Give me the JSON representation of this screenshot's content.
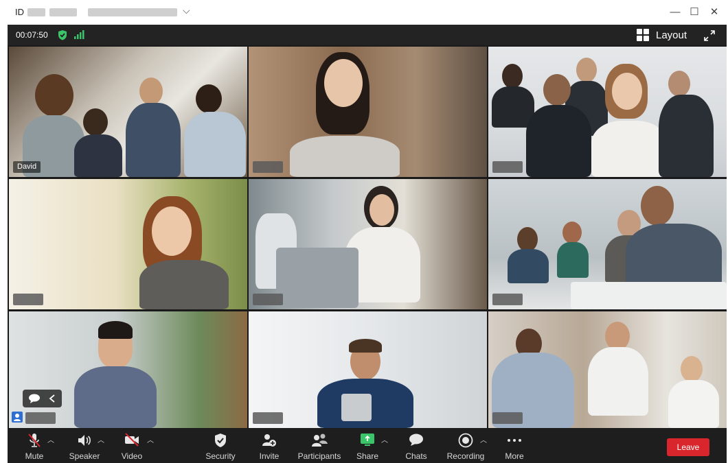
{
  "window": {
    "title_prefix": "ID",
    "minimize_glyph": "—",
    "maximize_glyph": "☐",
    "close_glyph": "✕",
    "chevron_glyph": "⌵"
  },
  "topbar": {
    "timer": "00:07:50",
    "shield_icon": "shield-check-icon",
    "signal_icon": "signal-icon",
    "layout_label": "Layout",
    "expand_icon": "expand-icon",
    "accent_green": "#3cc46b"
  },
  "tiles": [
    {
      "name": "David",
      "name_visible": true
    },
    {
      "name": "",
      "name_visible": false
    },
    {
      "name": "",
      "name_visible": false
    },
    {
      "name": "",
      "name_visible": false
    },
    {
      "name": "",
      "name_visible": false,
      "active": true
    },
    {
      "name": "",
      "name_visible": false
    },
    {
      "name": "",
      "name_visible": false
    },
    {
      "name": "",
      "name_visible": false
    },
    {
      "name": "",
      "name_visible": false
    }
  ],
  "toolbar": {
    "mute": "Mute",
    "speaker": "Speaker",
    "video": "Video",
    "security": "Security",
    "invite": "Invite",
    "participants": "Participants",
    "share": "Share",
    "chats": "Chats",
    "recording": "Recording",
    "more": "More",
    "leave": "Leave",
    "leave_color": "#d9262c",
    "share_color": "#3cc46b"
  }
}
